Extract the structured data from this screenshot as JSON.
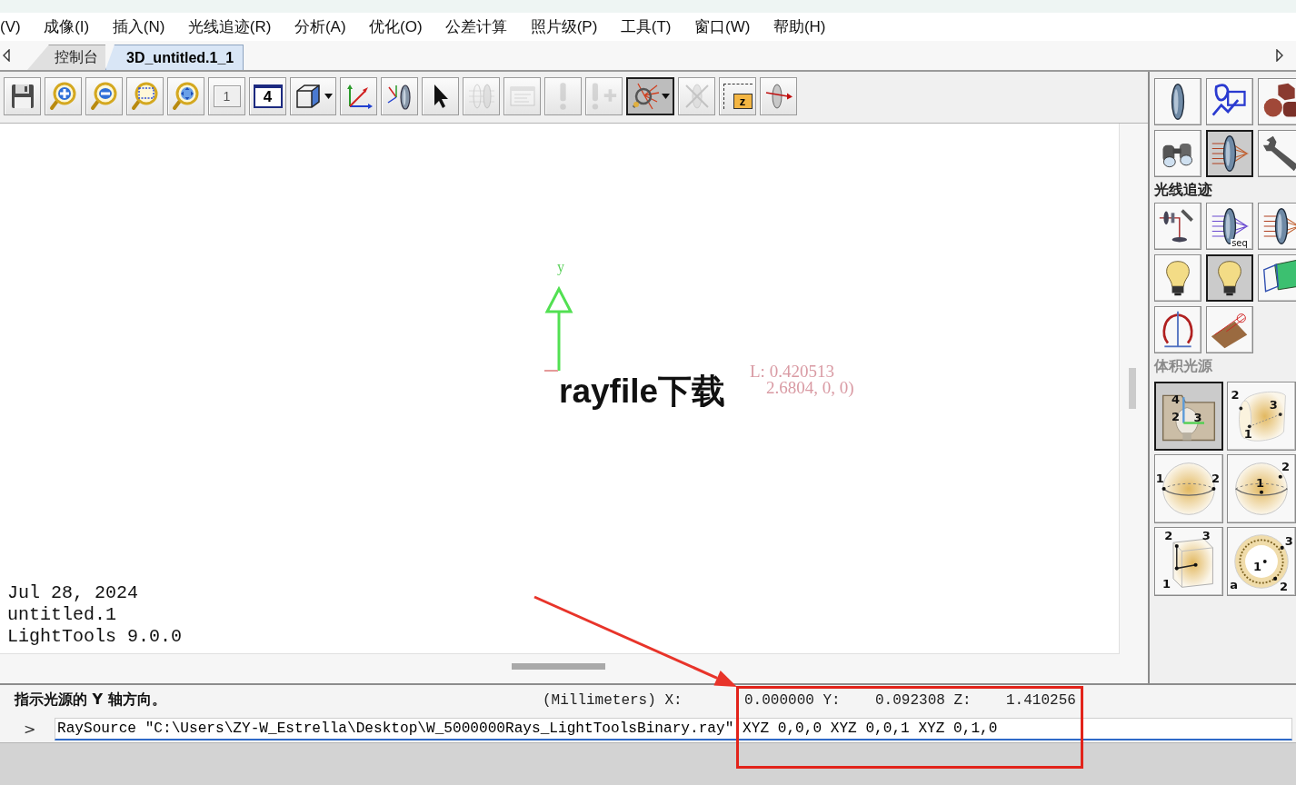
{
  "menu_bar": {
    "items": [
      "(V)",
      "成像(I)",
      "插入(N)",
      "光线追迹(R)",
      "分析(A)",
      "优化(O)",
      "公差计算",
      "照片级(P)",
      "工具(T)",
      "窗口(W)",
      "帮助(H)"
    ]
  },
  "tabs": [
    {
      "label": "控制台",
      "selected": false
    },
    {
      "label": "3D_untitled.1_1",
      "selected": true
    }
  ],
  "toolbar": {
    "items": [
      {
        "kind": "save",
        "selected": false,
        "disabled": false
      },
      {
        "kind": "zoom_in",
        "selected": false,
        "disabled": false
      },
      {
        "kind": "zoom_out",
        "selected": false,
        "disabled": false
      },
      {
        "kind": "zoom_window",
        "selected": false,
        "disabled": false
      },
      {
        "kind": "zoom_fit",
        "selected": false,
        "disabled": false
      },
      {
        "kind": "view_single",
        "label": "1",
        "selected": false,
        "disabled": false
      },
      {
        "kind": "view_quad",
        "label": "4",
        "selected": false,
        "disabled": false
      },
      {
        "kind": "view_3d",
        "dropdown": true,
        "selected": false,
        "disabled": false
      },
      {
        "kind": "axes",
        "selected": false,
        "disabled": false
      },
      {
        "kind": "lens_axes",
        "selected": false,
        "disabled": false
      },
      {
        "kind": "pointer",
        "selected": false,
        "disabled": false
      },
      {
        "kind": "lens_grey",
        "selected": false,
        "disabled": true
      },
      {
        "kind": "properties",
        "selected": false,
        "disabled": true
      },
      {
        "kind": "alert",
        "selected": false,
        "disabled": true
      },
      {
        "kind": "alert_add",
        "selected": false,
        "disabled": true
      },
      {
        "kind": "ray_probe",
        "dropdown": true,
        "selected": true,
        "disabled": false
      },
      {
        "kind": "cross_lens",
        "selected": false,
        "disabled": true
      },
      {
        "kind": "z_box",
        "label": "z",
        "selected": false,
        "disabled": false
      },
      {
        "kind": "ray_lens",
        "selected": false,
        "disabled": false
      }
    ]
  },
  "viewport": {
    "axis_label": "y",
    "readouts": [
      "L: 0.420513",
      "2.6804, 0, 0)"
    ],
    "caption": "rayfile下载",
    "info_lines": [
      "Jul 28, 2024",
      "untitled.1",
      "LightTools 9.0.0"
    ]
  },
  "palette": {
    "sections": [
      {
        "kind": "compact",
        "items": [
          {
            "kind": "lens",
            "selected": false
          },
          {
            "kind": "sketch",
            "selected": false
          },
          {
            "kind": "solids",
            "selected": false
          },
          {
            "kind": "binoculars",
            "selected": false
          },
          {
            "kind": "lens_rays",
            "selected": true
          },
          {
            "kind": "wrench",
            "selected": false
          }
        ]
      },
      {
        "kind": "compact",
        "title": "光线追迹",
        "items": [
          {
            "kind": "bench",
            "selected": false
          },
          {
            "kind": "lens_seq",
            "selected": false,
            "marks": [
              "seq"
            ]
          },
          {
            "kind": "lens_rays",
            "selected": false
          },
          {
            "kind": "bulb",
            "selected": false
          },
          {
            "kind": "bulb",
            "selected": true
          },
          {
            "kind": "planes",
            "selected": false
          },
          {
            "kind": "probe",
            "selected": false
          },
          {
            "kind": "receiver",
            "selected": false
          }
        ]
      },
      {
        "kind": "large",
        "title": "体积光源",
        "items": [
          {
            "kind": "folder_bulb",
            "selected": true,
            "marks": [
              "4",
              "2",
              "3"
            ]
          },
          {
            "kind": "cylinder",
            "selected": false,
            "marks": [
              "2",
              "3",
              "1"
            ]
          },
          {
            "kind": "sphere_edge",
            "selected": false,
            "marks": [
              "1",
              "2"
            ]
          },
          {
            "kind": "sphere_center",
            "selected": false,
            "marks": [
              "2",
              "1"
            ]
          },
          {
            "kind": "box",
            "selected": false,
            "marks": [
              "2",
              "3",
              "1"
            ]
          },
          {
            "kind": "ring",
            "selected": false,
            "marks": [
              "3",
              "1",
              "a",
              "2"
            ]
          }
        ]
      }
    ]
  },
  "status_bar": {
    "message": "指示光源的 Y 轴方向。",
    "units": "(Millimeters)",
    "coordinates": [
      {
        "axis": "X:",
        "value": "0.000000"
      },
      {
        "axis": "Y:",
        "value": "0.092308"
      },
      {
        "axis": "Z:",
        "value": "1.410256"
      }
    ]
  },
  "command_line": {
    "prompt": ">",
    "value": "RaySource \"C:\\Users\\ZY-W_Estrella\\Desktop\\W_5000000Rays_LightToolsBinary.ray\" XYZ 0,0,0 XYZ 0,0,1 XYZ 0,1,0"
  },
  "annotations": [
    {
      "kind": "arrow"
    },
    {
      "kind": "frame"
    }
  ]
}
